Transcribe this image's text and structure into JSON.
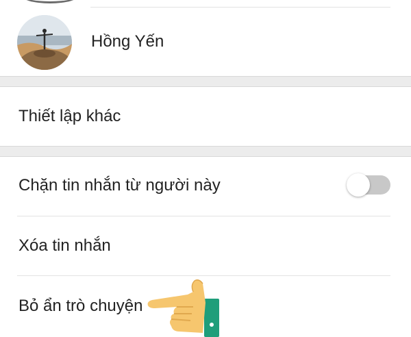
{
  "contact": {
    "name": "Hồng Yến"
  },
  "sections": {
    "other_settings_label": "Thiết lập khác"
  },
  "rows": {
    "block_messages_label": "Chặn tin nhắn từ người này",
    "block_messages_enabled": false,
    "delete_messages_label": "Xóa tin nhắn",
    "unhide_chat_label": "Bỏ ẩn trò chuyện"
  },
  "colors": {
    "toggle_off_track": "#c8c8c8",
    "section_gap": "#ececec",
    "hand_skin": "#f6c66e",
    "cuff": "#1f9e7a"
  },
  "icons": {
    "avatar": "contact-photo",
    "pointer": "pointing-hand-icon"
  }
}
